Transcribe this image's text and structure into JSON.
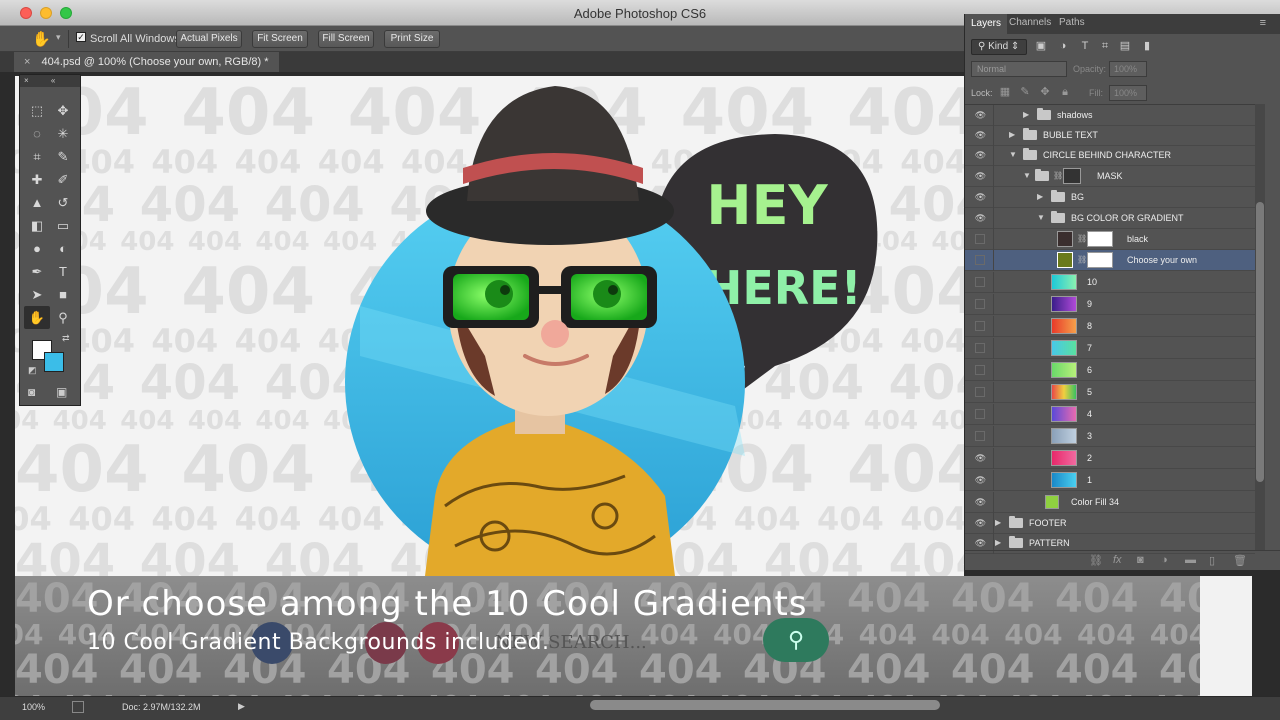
{
  "window": {
    "title": "Adobe Photoshop CS6"
  },
  "options_bar": {
    "scroll_all_label": "Scroll All Windows",
    "buttons": [
      "Actual Pixels",
      "Fit Screen",
      "Fill Screen",
      "Print Size"
    ]
  },
  "document": {
    "tab_title": "404.psd @ 100% (Choose your own, RGB/8) *"
  },
  "canvas": {
    "pattern_text": "404",
    "bubble_line1": "HEY",
    "bubble_line2": "THERE!",
    "colors": {
      "bubble": "#333033",
      "bubble_text": "#a6f28f",
      "circle": "#3bbde8",
      "background": "#f3f3f3"
    }
  },
  "panel": {
    "tabs": [
      "Layers",
      "Channels",
      "Paths"
    ],
    "filter_kind": "Kind",
    "blend_mode": "Normal",
    "opacity_label": "Opacity:",
    "opacity_value": "100%",
    "lock_label": "Lock:",
    "fill_label": "Fill:",
    "fill_value": "100%",
    "layers": [
      {
        "name": "shadows",
        "type": "group"
      },
      {
        "name": "BUBLE TEXT",
        "type": "group"
      },
      {
        "name": "CIRCLE BEHIND CHARACTER",
        "type": "group"
      },
      {
        "name": "MASK",
        "type": "group"
      },
      {
        "name": "BG",
        "type": "group"
      },
      {
        "name": "BG COLOR OR GRADIENT",
        "type": "group"
      },
      {
        "name": "black",
        "type": "fill"
      },
      {
        "name": "Choose your own",
        "type": "fill",
        "selected": true
      },
      {
        "name": "10",
        "type": "gradient"
      },
      {
        "name": "9",
        "type": "gradient"
      },
      {
        "name": "8",
        "type": "gradient"
      },
      {
        "name": "7",
        "type": "gradient"
      },
      {
        "name": "6",
        "type": "gradient"
      },
      {
        "name": "5",
        "type": "gradient"
      },
      {
        "name": "4",
        "type": "gradient"
      },
      {
        "name": "3",
        "type": "gradient"
      },
      {
        "name": "2",
        "type": "gradient"
      },
      {
        "name": "1",
        "type": "gradient"
      },
      {
        "name": "Color Fill 34",
        "type": "fill"
      },
      {
        "name": "FOOTER",
        "type": "group"
      },
      {
        "name": "PATTERN",
        "type": "group"
      }
    ]
  },
  "overlay": {
    "title": "Or choose among the 10 Cool Gradients",
    "subtitle": "10 Cool Gradient Backgrounds included.",
    "search_text": "NEW SEARCH..."
  },
  "status": {
    "zoom": "100%",
    "doc_info": "Doc: 2.97M/132.2M"
  }
}
